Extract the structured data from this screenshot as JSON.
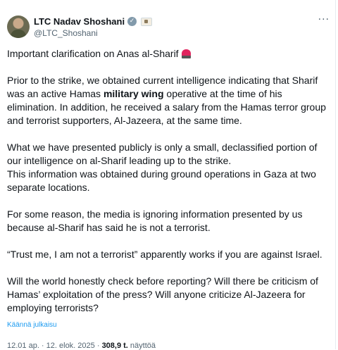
{
  "author": {
    "name": "LTC Nadav Shoshani",
    "handle": "@LTC_Shoshani"
  },
  "post": {
    "line1": "Important clarification on Anas al-Sharif",
    "p2_a": "Prior to the strike, we obtained current intelligence indicating that Sharif was an active Hamas ",
    "p2_bold": "military wing",
    "p2_b": " operative at the time of his elimination. In addition, he received a salary from the Hamas terror group and terrorist supporters, Al-Jazeera, at the same time.",
    "p3_a": "What we have presented publicly is only a small, declassified portion of our intelligence on al-Sharif leading up to the strike.",
    "p3_b": "This information was obtained during ground operations in Gaza at two separate locations.",
    "p4": "For some reason, the media is ignoring information presented by us because al-Sharif has said he is not a terrorist.",
    "p5": "“Trust me, I am not a terrorist” apparently works if you are against Israel.",
    "p6": "Will the world honestly check before reporting? Will there be criticism of Hamas’ exploitation of the press? Will anyone criticize Al-Jazeera for employing terrorists?"
  },
  "translate_label": "Käännä julkaisu",
  "meta": {
    "time": "12.01 ap.",
    "sep1": " · ",
    "date": "12. elok. 2025",
    "sep2": " · ",
    "views": "308,9 t.",
    "views_label": " näyttöä"
  },
  "icons": {
    "verified": "verified-badge-icon",
    "affiliation": "affiliation-badge-icon",
    "more": "more-options-icon",
    "siren": "siren-emoji-icon"
  },
  "colors": {
    "link": "#1d9bf0",
    "secondary_text": "#536471",
    "primary_text": "#0f1419"
  }
}
